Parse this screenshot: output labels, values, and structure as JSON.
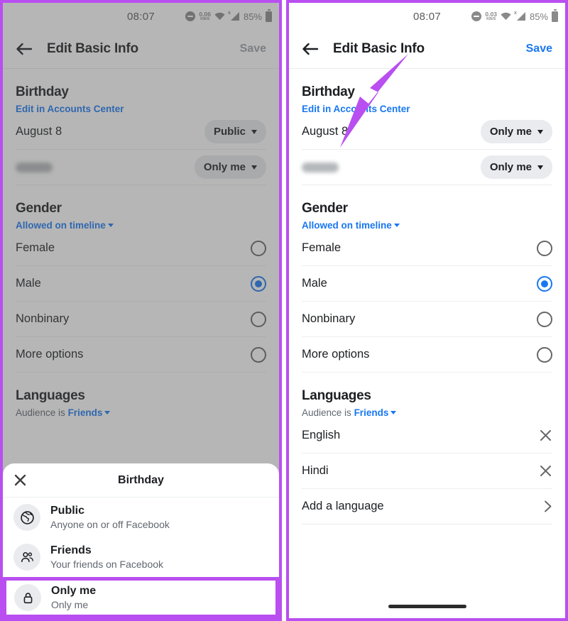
{
  "annotation": {
    "arrow_color": "#b94ff0",
    "points_to": "save-button"
  },
  "theme": {
    "accent_blue": "#1877f2",
    "highlight_purple": "#b94ff0",
    "text_primary": "#1c1e21",
    "text_secondary": "#606770",
    "pill_bg": "#e9ebee"
  },
  "panels": [
    {
      "id": "before",
      "dimmed": true,
      "status_bar": {
        "time": "08:07",
        "data_rate_value": "0.06",
        "data_rate_unit": "KB/S",
        "battery_percent": "85%",
        "icons": [
          "dnd-icon",
          "netspeed-icon",
          "wifi-icon",
          "signal-icon",
          "battery-icon"
        ]
      },
      "app_bar": {
        "back_icon": "back-arrow-icon",
        "title": "Edit Basic Info",
        "save_label": "Save",
        "save_enabled": false
      },
      "birthday": {
        "title": "Birthday",
        "subtitle": "Edit in Accounts Center",
        "date_label": "August 8",
        "date_audience": "Public",
        "year_label": "",
        "year_audience": "Only me"
      },
      "gender": {
        "title": "Gender",
        "subtitle": "Allowed on timeline",
        "options": [
          {
            "label": "Female",
            "selected": false
          },
          {
            "label": "Male",
            "selected": true
          },
          {
            "label": "Nonbinary",
            "selected": false
          },
          {
            "label": "More options",
            "selected": false
          }
        ]
      },
      "languages": {
        "title": "Languages",
        "subtitle_prefix": "Audience is",
        "subtitle_link": "Friends",
        "items": [],
        "add_label": ""
      },
      "sheet": {
        "visible": true,
        "close_icon": "close-icon",
        "title": "Birthday",
        "options": [
          {
            "icon": "globe-icon",
            "title": "Public",
            "desc": "Anyone on or off Facebook",
            "selected": false
          },
          {
            "icon": "friends-icon",
            "title": "Friends",
            "desc": "Your friends on Facebook",
            "selected": false
          },
          {
            "icon": "lock-icon",
            "title": "Only me",
            "desc": "Only me",
            "selected": true
          }
        ]
      }
    },
    {
      "id": "after",
      "dimmed": false,
      "status_bar": {
        "time": "08:07",
        "data_rate_value": "0.03",
        "data_rate_unit": "KB/S",
        "battery_percent": "85%",
        "icons": [
          "dnd-icon",
          "netspeed-icon",
          "wifi-icon",
          "signal-icon",
          "battery-icon"
        ]
      },
      "app_bar": {
        "back_icon": "back-arrow-icon",
        "title": "Edit Basic Info",
        "save_label": "Save",
        "save_enabled": true
      },
      "birthday": {
        "title": "Birthday",
        "subtitle": "Edit in Accounts Center",
        "date_label": "August 8",
        "date_audience": "Only me",
        "year_label": "",
        "year_audience": "Only me"
      },
      "gender": {
        "title": "Gender",
        "subtitle": "Allowed on timeline",
        "options": [
          {
            "label": "Female",
            "selected": false
          },
          {
            "label": "Male",
            "selected": true
          },
          {
            "label": "Nonbinary",
            "selected": false
          },
          {
            "label": "More options",
            "selected": false
          }
        ]
      },
      "languages": {
        "title": "Languages",
        "subtitle_prefix": "Audience is",
        "subtitle_link": "Friends",
        "items": [
          {
            "label": "English",
            "action_icon": "close-icon"
          },
          {
            "label": "Hindi",
            "action_icon": "close-icon"
          }
        ],
        "add_label": "Add a language"
      },
      "sheet": {
        "visible": false,
        "title": "",
        "options": []
      }
    }
  ]
}
